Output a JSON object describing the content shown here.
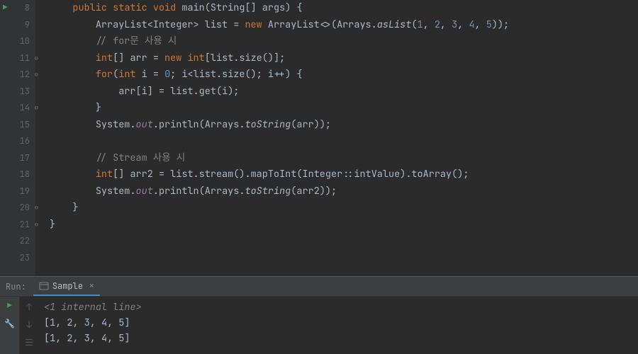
{
  "gutter": {
    "lines": [
      "8",
      "9",
      "10",
      "11",
      "12",
      "13",
      "14",
      "15",
      "16",
      "17",
      "18",
      "19",
      "20",
      "21",
      "22",
      "23"
    ]
  },
  "code": {
    "l8": {
      "kw_public": "public",
      "kw_static": "static",
      "kw_void": "void",
      "method": "main",
      "lparen": "(",
      "type": "String",
      "brackets": "[] ",
      "param": "args",
      "rparen_brace": ") {"
    },
    "l9": {
      "type1": "ArrayList",
      "lt": "<",
      "type2": "Integer",
      "gt": "> ",
      "var": "list ",
      "eq": "= ",
      "kw_new": "new",
      "type3": " ArrayList",
      "diamond": "<>(",
      "cls": "Arrays",
      "dot": ".",
      "as": "asList",
      "lp": "(",
      "n1": "1",
      "c1": ", ",
      "n2": "2",
      "c2": ", ",
      "n3": "3",
      "c3": ", ",
      "n4": "4",
      "c4": ", ",
      "n5": "5",
      "rp": "));"
    },
    "l10": {
      "comment": "// for문 사용 시"
    },
    "l11": {
      "kw_int": "int",
      "br": "[] ",
      "var": "arr ",
      "eq": "= ",
      "kw_new": "new ",
      "kw_int2": "int",
      "lb": "[",
      "lst": "list",
      "dot": ".",
      "m": "size",
      "end": "()];"
    },
    "l12": {
      "kw_for": "for",
      "lp": "(",
      "kw_int": "int",
      "sp": " ",
      "i": "i ",
      "eq": "= ",
      "n0": "0",
      "semi": "; ",
      "i2": "i",
      "lt": "<",
      "lst": "list",
      "dot": ".",
      "m": "size",
      "paren": "()",
      "semi2": "; ",
      "i3": "i",
      "inc": "++) {"
    },
    "l13": {
      "arr": "arr",
      "lb": "[",
      "i": "i",
      "rb": "] ",
      "eq": "= ",
      "lst": "list",
      "dot": ".",
      "m": "get",
      "lp": "(",
      "i2": "i",
      "rp": ");"
    },
    "l14": {
      "brace": "}"
    },
    "l15": {
      "sys": "System",
      "dot": ".",
      "out": "out",
      "dot2": ".",
      "m": "println",
      "lp": "(",
      "cls": "Arrays",
      "dot3": ".",
      "ts": "toString",
      "lp2": "(",
      "arr": "arr",
      "rp": "));"
    },
    "l17": {
      "comment": "// Stream 사용 시"
    },
    "l18": {
      "kw_int": "int",
      "br": "[] ",
      "var": "arr2 ",
      "eq": "= ",
      "lst": "list",
      "dot": ".",
      "m1": "stream",
      "p1": "().",
      "m2": "mapToInt",
      "lp": "(",
      "cls": "Integer",
      "cc": "::",
      "m3": "intValue",
      "rp": ").",
      "m4": "toArray",
      "end": "();"
    },
    "l19": {
      "sys": "System",
      "dot": ".",
      "out": "out",
      "dot2": ".",
      "m": "println",
      "lp": "(",
      "cls": "Arrays",
      "dot3": ".",
      "ts": "toString",
      "lp2": "(",
      "arr": "arr2",
      "rp": "));"
    },
    "l20": {
      "brace": "}"
    },
    "l21": {
      "brace": "}"
    }
  },
  "run": {
    "label": "Run:",
    "tab_name": "Sample",
    "internal": "<1 internal line>",
    "out1": "[1, 2, 3, 4, 5]",
    "out2": "[1, 2, 3, 4, 5]"
  }
}
